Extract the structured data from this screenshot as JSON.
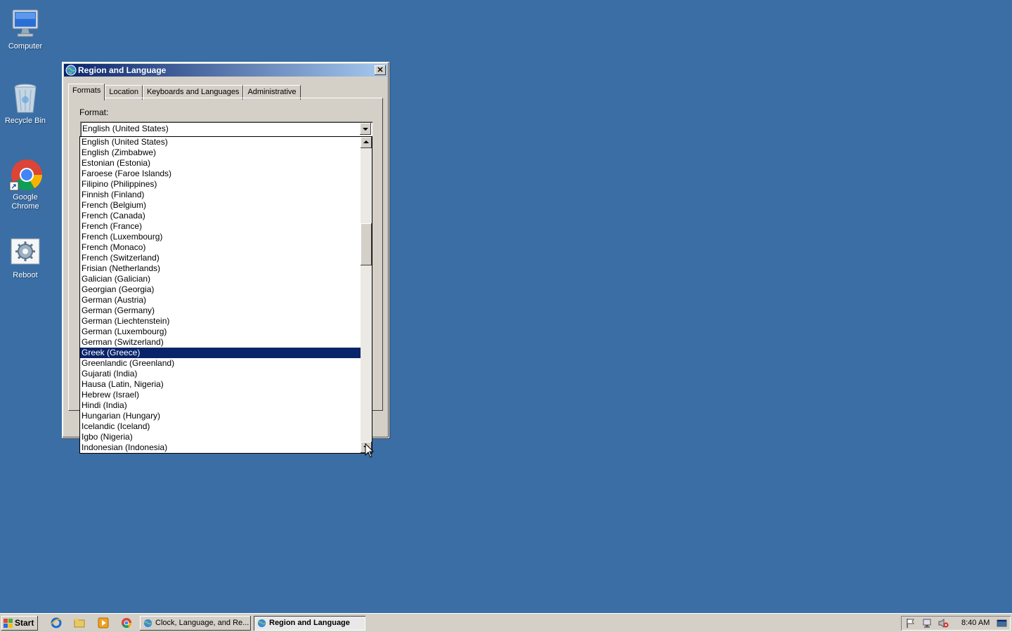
{
  "desktop": {
    "icons": [
      {
        "label": "Computer",
        "icon": "computer-icon"
      },
      {
        "label": "Recycle Bin",
        "icon": "recycle-bin-icon"
      },
      {
        "label": "Google Chrome",
        "icon": "chrome-icon"
      },
      {
        "label": "Reboot",
        "icon": "reboot-icon"
      }
    ]
  },
  "window": {
    "title": "Region and Language",
    "close_label": "✕",
    "tabs": [
      {
        "label": "Formats"
      },
      {
        "label": "Location"
      },
      {
        "label": "Keyboards and Languages"
      },
      {
        "label": "Administrative"
      }
    ],
    "format_label": "Format:",
    "format_value": "English (United States)",
    "dropdown": {
      "items": [
        "English (United States)",
        "English (Zimbabwe)",
        "Estonian (Estonia)",
        "Faroese (Faroe Islands)",
        "Filipino (Philippines)",
        "Finnish (Finland)",
        "French (Belgium)",
        "French (Canada)",
        "French (France)",
        "French (Luxembourg)",
        "French (Monaco)",
        "French (Switzerland)",
        "Frisian (Netherlands)",
        "Galician (Galician)",
        "Georgian (Georgia)",
        "German (Austria)",
        "German (Germany)",
        "German (Liechtenstein)",
        "German (Luxembourg)",
        "German (Switzerland)",
        "Greek (Greece)",
        "Greenlandic (Greenland)",
        "Gujarati (India)",
        "Hausa (Latin, Nigeria)",
        "Hebrew (Israel)",
        "Hindi (India)",
        "Hungarian (Hungary)",
        "Icelandic (Iceland)",
        "Igbo (Nigeria)",
        "Indonesian (Indonesia)"
      ],
      "selected": "Greek (Greece)",
      "scroll_position": 0.3
    }
  },
  "taskbar": {
    "start_label": "Start",
    "quick_launch": [
      "ie-icon",
      "explorer-icon",
      "media-player-icon",
      "chrome-icon"
    ],
    "buttons": [
      {
        "label": "Clock, Language, and Re...",
        "icon": "control-panel-icon",
        "active": false
      },
      {
        "label": "Region and Language",
        "icon": "globe-icon",
        "active": true
      }
    ],
    "tray_icons": [
      "action-center-flag-icon",
      "network-icon",
      "volume-muted-icon",
      "show-desktop-icon"
    ],
    "clock": "8:40 AM"
  }
}
